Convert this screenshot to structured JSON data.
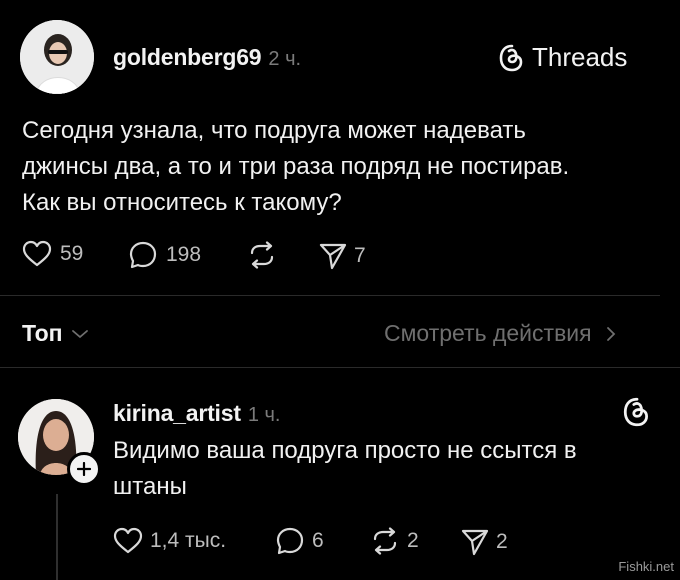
{
  "post": {
    "username": "goldenberg69",
    "time": "2 ч.",
    "brand": "Threads",
    "text_lines": [
      "Сегодня узнала, что подруга может надевать",
      "джинсы два, а то и три раза подряд не постирав.",
      "Как вы относитесь к такому?"
    ],
    "likes": "59",
    "comments": "198",
    "shares": "7"
  },
  "sort": {
    "label": "Топ",
    "activity_link": "Смотреть действия"
  },
  "reply": {
    "username": "kirina_artist",
    "time": "1 ч.",
    "text_lines": [
      "Видимо ваша подруга просто не ссытся в",
      "штаны"
    ],
    "likes": "1,4 тыс.",
    "comments": "6",
    "reposts": "2",
    "shares": "2"
  },
  "watermark": "Fishki.net",
  "colors": {
    "background": "#000000",
    "text": "#f3f3f3",
    "muted": "#7b7b7b",
    "divider": "#2a2a2a"
  }
}
